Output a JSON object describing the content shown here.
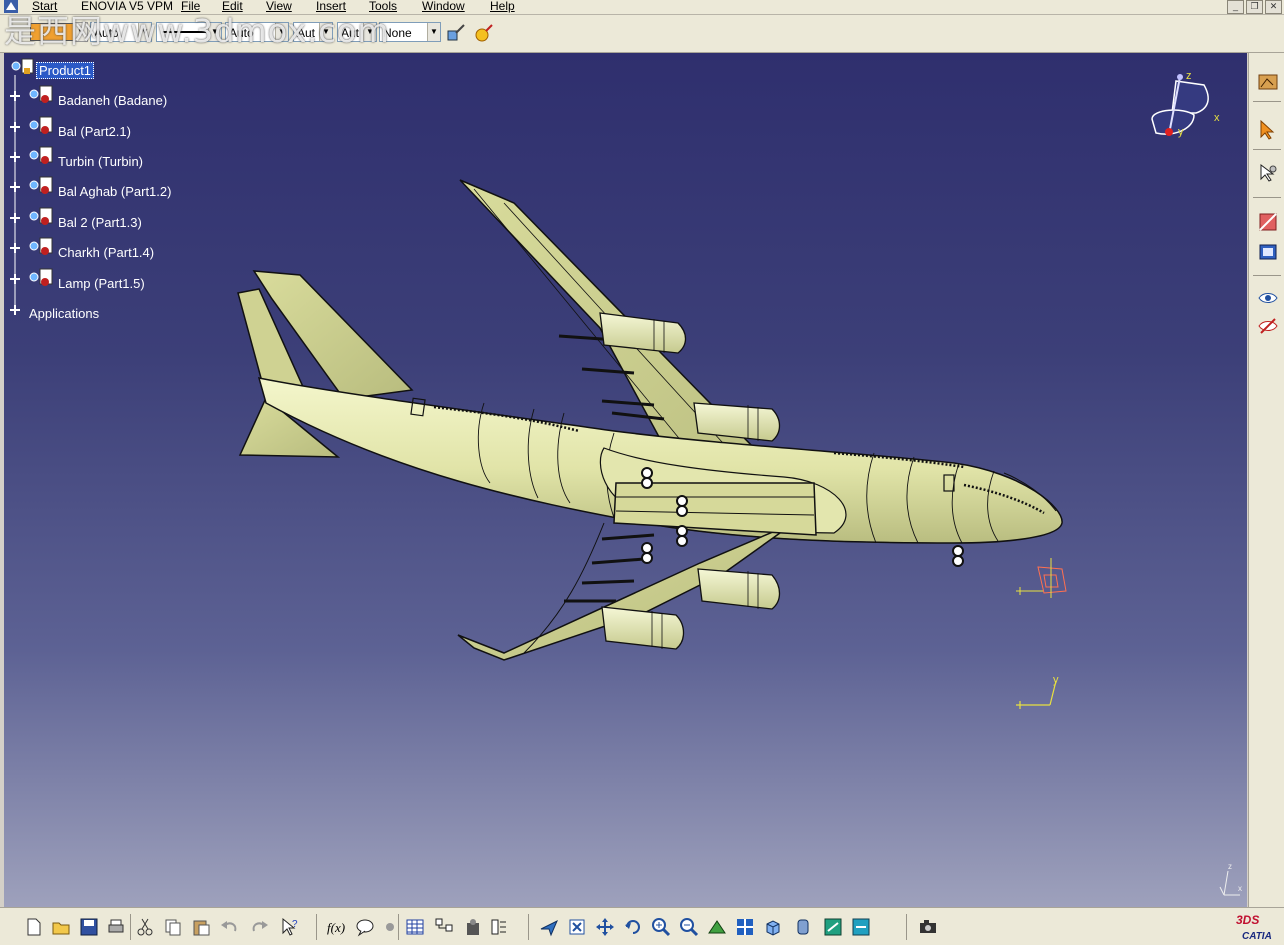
{
  "menubar": {
    "items": [
      {
        "label": "Start"
      },
      {
        "label": "ENOVIA V5 VPM"
      },
      {
        "label": "File"
      },
      {
        "label": "Edit"
      },
      {
        "label": "View"
      },
      {
        "label": "Insert"
      },
      {
        "label": "Tools"
      },
      {
        "label": "Window"
      },
      {
        "label": "Help"
      }
    ]
  },
  "watermark": "是西网www.3dmox.com",
  "toolbar_top": {
    "combos": [
      {
        "value": "Auto"
      },
      {
        "value": "Auto"
      },
      {
        "value": "Aut"
      },
      {
        "value": "Aut"
      },
      {
        "value": "None"
      }
    ],
    "fill_color": "#f0a030",
    "icons": [
      "painter-brush-icon",
      "magic-wand-icon"
    ]
  },
  "tree": {
    "root": "Product1",
    "children": [
      {
        "label": "Badaneh (Badane)"
      },
      {
        "label": "Bal (Part2.1)"
      },
      {
        "label": "Turbin (Turbin)"
      },
      {
        "label": "Bal Aghab (Part1.2)"
      },
      {
        "label": "Bal 2 (Part1.3)"
      },
      {
        "label": "Charkh (Part1.4)"
      },
      {
        "label": "Lamp (Part1.5)"
      }
    ],
    "applications": "Applications"
  },
  "compass": {
    "axes": [
      "z",
      "x",
      "y"
    ]
  },
  "axis_triad": {
    "axes": [
      "y",
      "x",
      "z"
    ]
  },
  "logo": {
    "brand": "CATIA",
    "mark": "3DS"
  },
  "colors": {
    "model": "#e6e9b0",
    "model_edge": "#0a0a0a",
    "tree_selection": "#2b59c6"
  },
  "toolbar_right": {
    "icons": [
      "workbench-icon",
      "select-icon",
      "snap-icon",
      "section-icon",
      "catalog-icon",
      "hide-show-icon",
      "swap-visible-icon"
    ]
  },
  "toolbar_bottom": {
    "icons": [
      "new-icon",
      "open-icon",
      "save-icon",
      "print-icon",
      "cut-icon",
      "copy-icon",
      "paste-icon",
      "undo-icon",
      "redo-icon",
      "whats-this-icon",
      "formula-icon",
      "comment-icon",
      "knowledge-icon",
      "table-icon",
      "tree-expand-icon",
      "scan-icon",
      "sequence-icon",
      "fly-mode-icon",
      "fit-all-icon",
      "pan-icon",
      "rotate-icon",
      "zoom-in-icon",
      "zoom-out-icon",
      "normal-view-icon",
      "multi-view-icon",
      "iso-view-icon",
      "shading-icon",
      "hide-icon",
      "swap-icon",
      "capture-icon"
    ]
  }
}
